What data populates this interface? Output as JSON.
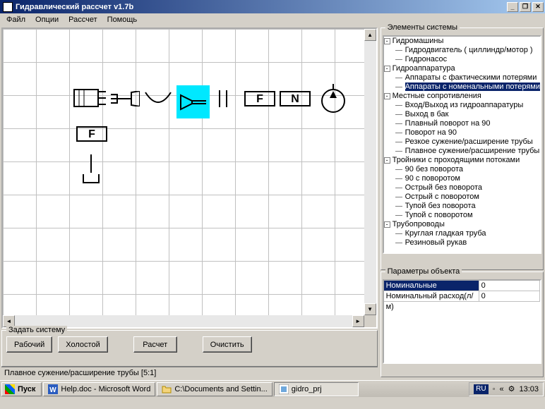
{
  "window": {
    "title": "Гидравлический рассчет v1.7b"
  },
  "menu": {
    "file": "Файл",
    "options": "Опции",
    "calc": "Рассчет",
    "help": "Помощь"
  },
  "bottom_group": {
    "legend": "Задать системy",
    "work_btn": "Рабочий",
    "idle_btn": "Холостой",
    "calc_btn": "Расчет",
    "clear_btn": "Очистить"
  },
  "statusbar": {
    "text": "Плавное сужение/расширение трубы [5:1]"
  },
  "tree_panel": {
    "legend": "Элементы системы",
    "nodes": {
      "hydro_machines": "Гидромашины",
      "hydro_motor": "Гидродвигатель ( циллиндр/мотор )",
      "hydro_pump": "Гидронасос",
      "hydro_apparatus": "Гидроаппаратyра",
      "app_actual": "Аппараты с фактическими потерями",
      "app_nominal": "Аппараты с номенальными потерями",
      "local_resist": "Местные сопротивления",
      "in_out": "Вход/Выход из гидроаппаратyры",
      "out_tank": "Выход в бак",
      "smooth_90": "Плавный поворот на 90",
      "turn_90": "Поворот на 90",
      "sharp_constrict": "Резкое сyжение/расширение трyбы",
      "smooth_constrict": "Плавное сyжение/расширение трyбы",
      "tees": "Тройники с проходящими потоками",
      "t90_no": "90 без поворота",
      "t90_yes": "90 с поворотом",
      "sharp_no": "Острый без поворота",
      "sharp_yes": "Острый с поворотом",
      "blunt_no": "Тупой без поворота",
      "blunt_yes": "Тупой с поворотом",
      "pipes": "Трубопроводы",
      "round_pipe": "Круглая гладкая труба",
      "rubber": "Резиновый рукав"
    }
  },
  "params_panel": {
    "legend": "Параметры объекта",
    "rows": {
      "nom_loss_label": "Номинальные потери(МПа",
      "nom_loss_val": "0",
      "nom_flow_label": "Номинальный расход(л/м)",
      "nom_flow_val": "0"
    }
  },
  "taskbar": {
    "start": "Пуск",
    "task1": "Help.doc - Microsoft Word",
    "task2": "C:\\Documents and Settin...",
    "task3": "gidro_prj",
    "lang": "RU",
    "time": "13:03"
  },
  "canvas_items": {
    "f1": "F",
    "n": "N",
    "f2": "F"
  }
}
